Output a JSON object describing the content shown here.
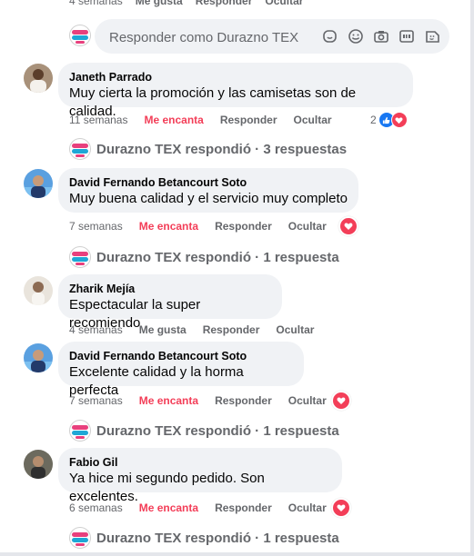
{
  "top_row": {
    "time": "4 semanas",
    "like": "Me gusta",
    "reply": "Responder",
    "hide": "Ocultar"
  },
  "reply_box": {
    "placeholder": "Responder como Durazno TEX"
  },
  "comments": [
    {
      "name": "Janeth Parrado",
      "text": "Muy cierta la promoción y las camisetas son de calidad.",
      "time": "11 semanas",
      "reaction": "Me encanta",
      "reply": "Responder",
      "hide": "Ocultar",
      "reaction_count": "2"
    },
    {
      "name": "David Fernando Betancourt Soto",
      "text": "Muy buena calidad y el servicio muy completo",
      "time": "7 semanas",
      "reaction": "Me encanta",
      "reply": "Responder",
      "hide": "Ocultar"
    },
    {
      "name": "Zharik Mejía",
      "text": "Espectacular la super recomiendo",
      "time": "4 semanas",
      "reaction": "Me gusta",
      "reply": "Responder",
      "hide": "Ocultar"
    },
    {
      "name": "David Fernando Betancourt Soto",
      "text": "Excelente calidad y la horma perfecta",
      "time": "7 semanas",
      "reaction": "Me encanta",
      "reply": "Responder",
      "hide": "Ocultar"
    },
    {
      "name": "Fabio Gil",
      "text": "Ya hice mi segundo pedido. Son excelentes.",
      "time": "6 semanas",
      "reaction": "Me encanta",
      "reply": "Responder",
      "hide": "Ocultar"
    }
  ],
  "replied": [
    "Durazno TEX respondió · 3 respuestas",
    "Durazno TEX respondió · 1 respuesta",
    "Durazno TEX respondió · 1 respuesta",
    "Durazno TEX respondió · 1 respuesta"
  ],
  "colors": {
    "love": "#f33e58",
    "like": "#1877f2",
    "bubble": "#f0f2f5",
    "meta": "#65676b"
  },
  "icons": [
    "sticker-icon",
    "emoji-icon",
    "camera-icon",
    "gif-icon",
    "avatar-sticker-icon",
    "like-reaction-icon",
    "love-reaction-icon"
  ]
}
